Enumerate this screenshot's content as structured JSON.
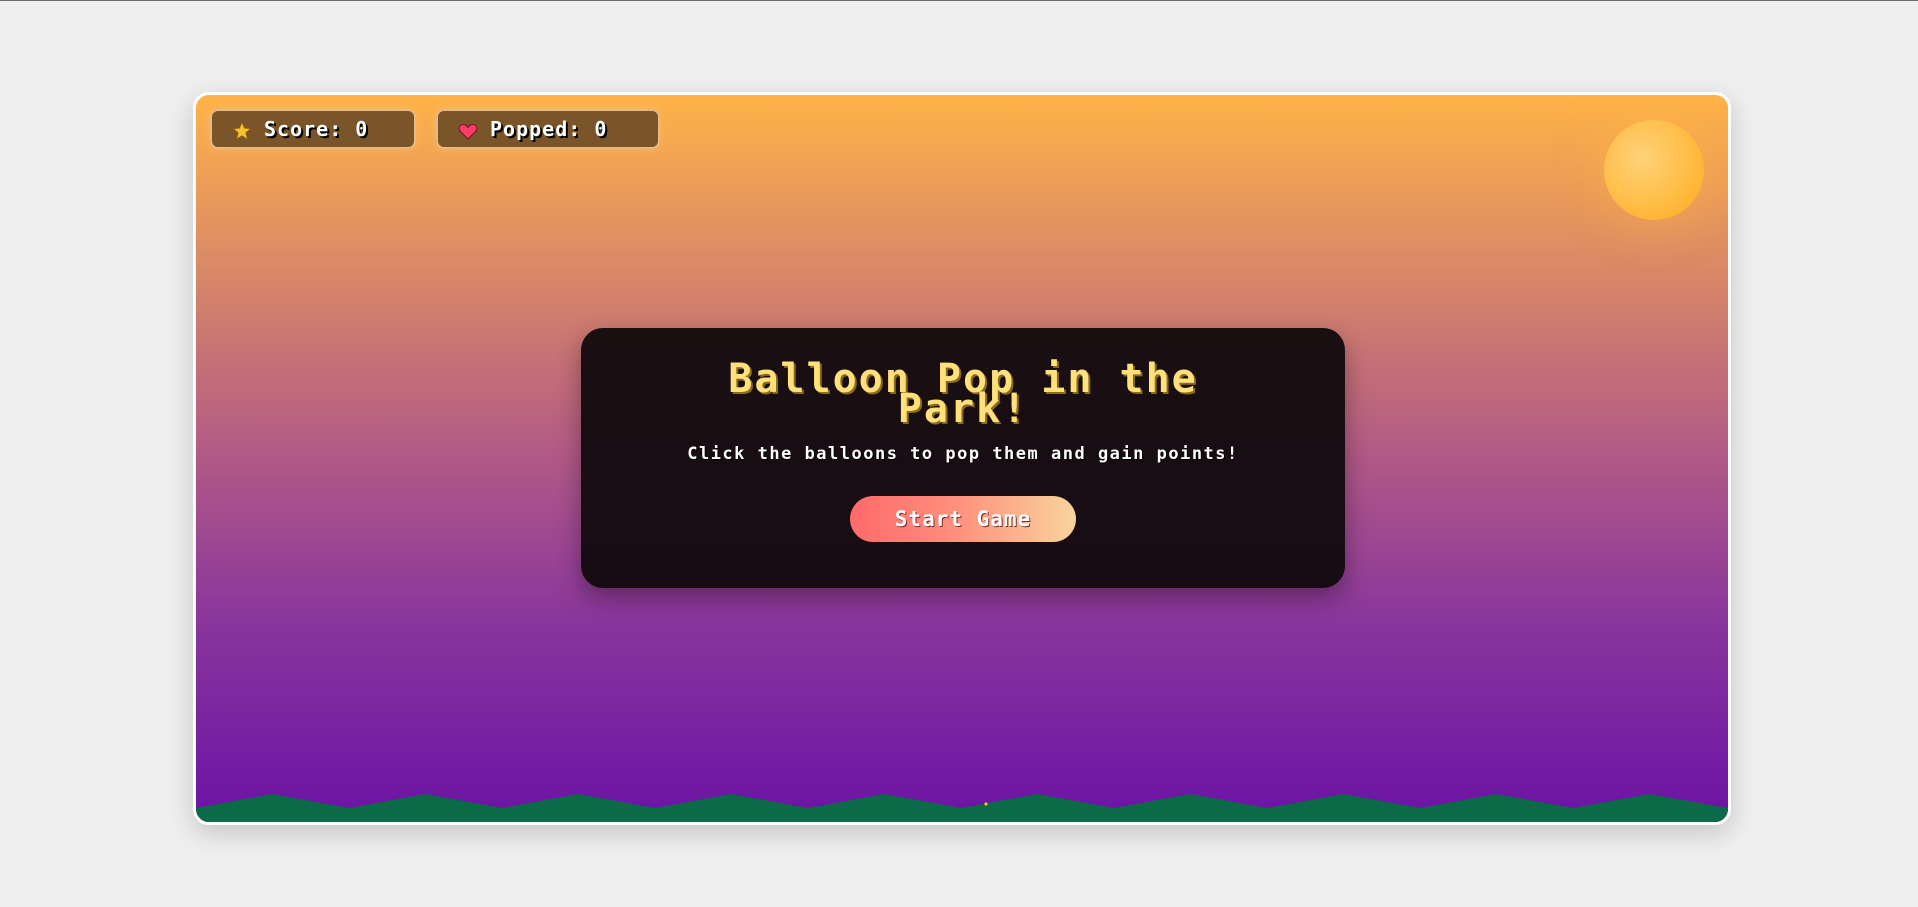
{
  "hud": {
    "score_label": "Score: 0",
    "popped_label": "Popped: 0",
    "score_icon": "star-icon",
    "popped_icon": "heart-icon"
  },
  "menu": {
    "title": "Balloon Pop in the Park!",
    "subtitle": "Click the balloons to pop them and gain points!",
    "start_label": "Start Game"
  },
  "colors": {
    "sky_top": "#ffb347",
    "sky_bottom": "#6c12a6",
    "grass": "#0b6a47",
    "title": "#ffe07a",
    "sun": "#ffbd45"
  }
}
